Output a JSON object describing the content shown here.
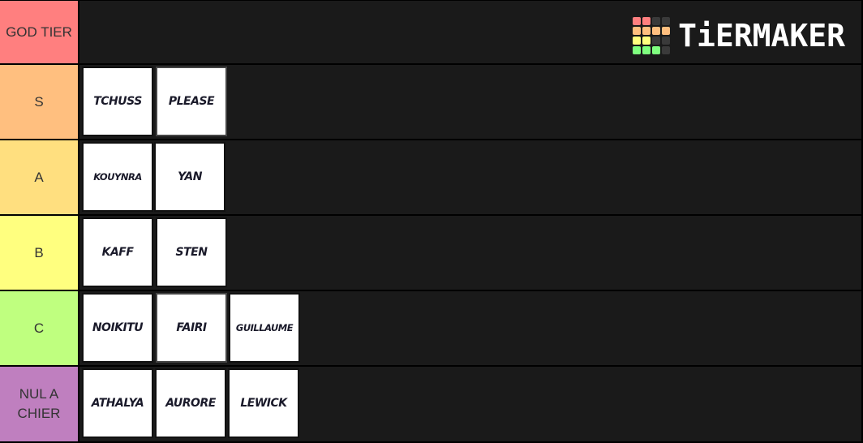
{
  "logo": {
    "text": "TiERMAKER",
    "grid_colors": [
      "#ff7f7f",
      "#ff7f7f",
      "#3a3a3a",
      "#3a3a3a",
      "#ffbf7f",
      "#ffbf7f",
      "#ffbf7f",
      "#ffbf7f",
      "#ffff7f",
      "#ffff7f",
      "#3a3a3a",
      "#3a3a3a",
      "#7fff7f",
      "#7fff7f",
      "#7fff7f",
      "#3a3a3a"
    ]
  },
  "tiers": [
    {
      "label": "GOD TIER",
      "color": "#ff7f7f",
      "items": []
    },
    {
      "label": "S",
      "color": "#ffbf7f",
      "items": [
        "TCHUSS",
        "PLEASE"
      ]
    },
    {
      "label": "A",
      "color": "#ffdf7f",
      "items": [
        "KOUYNRA",
        "YAN"
      ]
    },
    {
      "label": "B",
      "color": "#ffff7f",
      "items": [
        "KAFF",
        "STEN"
      ]
    },
    {
      "label": "C",
      "color": "#bfff7f",
      "items": [
        "NOIKITU",
        "FAIRI",
        "GUILLAUME"
      ]
    },
    {
      "label": "NUL A CHIER",
      "color": "#bf7fbf",
      "items": [
        "ATHALYA",
        "AURORE",
        "LEWICK"
      ]
    }
  ]
}
